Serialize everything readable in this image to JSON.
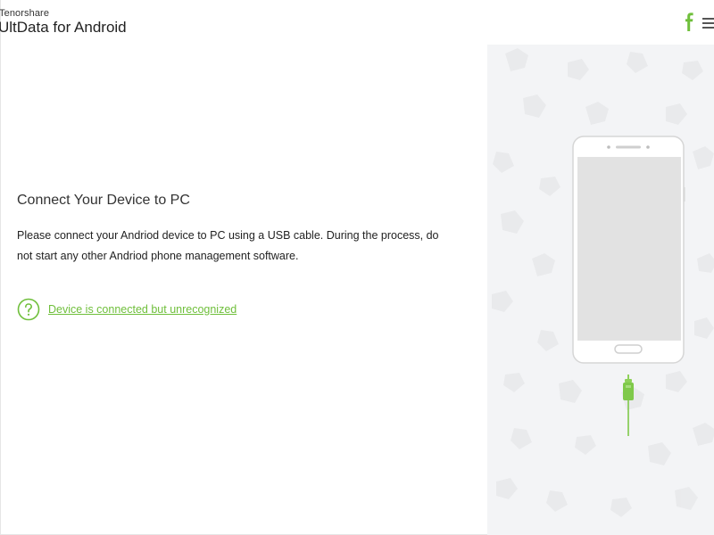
{
  "app": {
    "vendor": "Tenorshare",
    "name": "UltData for Android"
  },
  "header": {
    "facebook_icon": "facebook-icon",
    "menu_icon": "hamburger-menu-icon"
  },
  "main": {
    "title": "Connect Your Device to PC",
    "description": "Please connect your Andriod device to PC using a USB cable. During the process, do not start any other Andriod phone management software.",
    "help_link": "Device is connected but unrecognized",
    "help_icon": "question-circle-icon"
  },
  "illustration": {
    "phone_icon": "smartphone-illustration",
    "cable_icon": "usb-cable-icon"
  },
  "colors": {
    "accent": "#6fbf3b",
    "panel_bg": "#f3f4f6",
    "phone_screen": "#e2e2e2"
  }
}
